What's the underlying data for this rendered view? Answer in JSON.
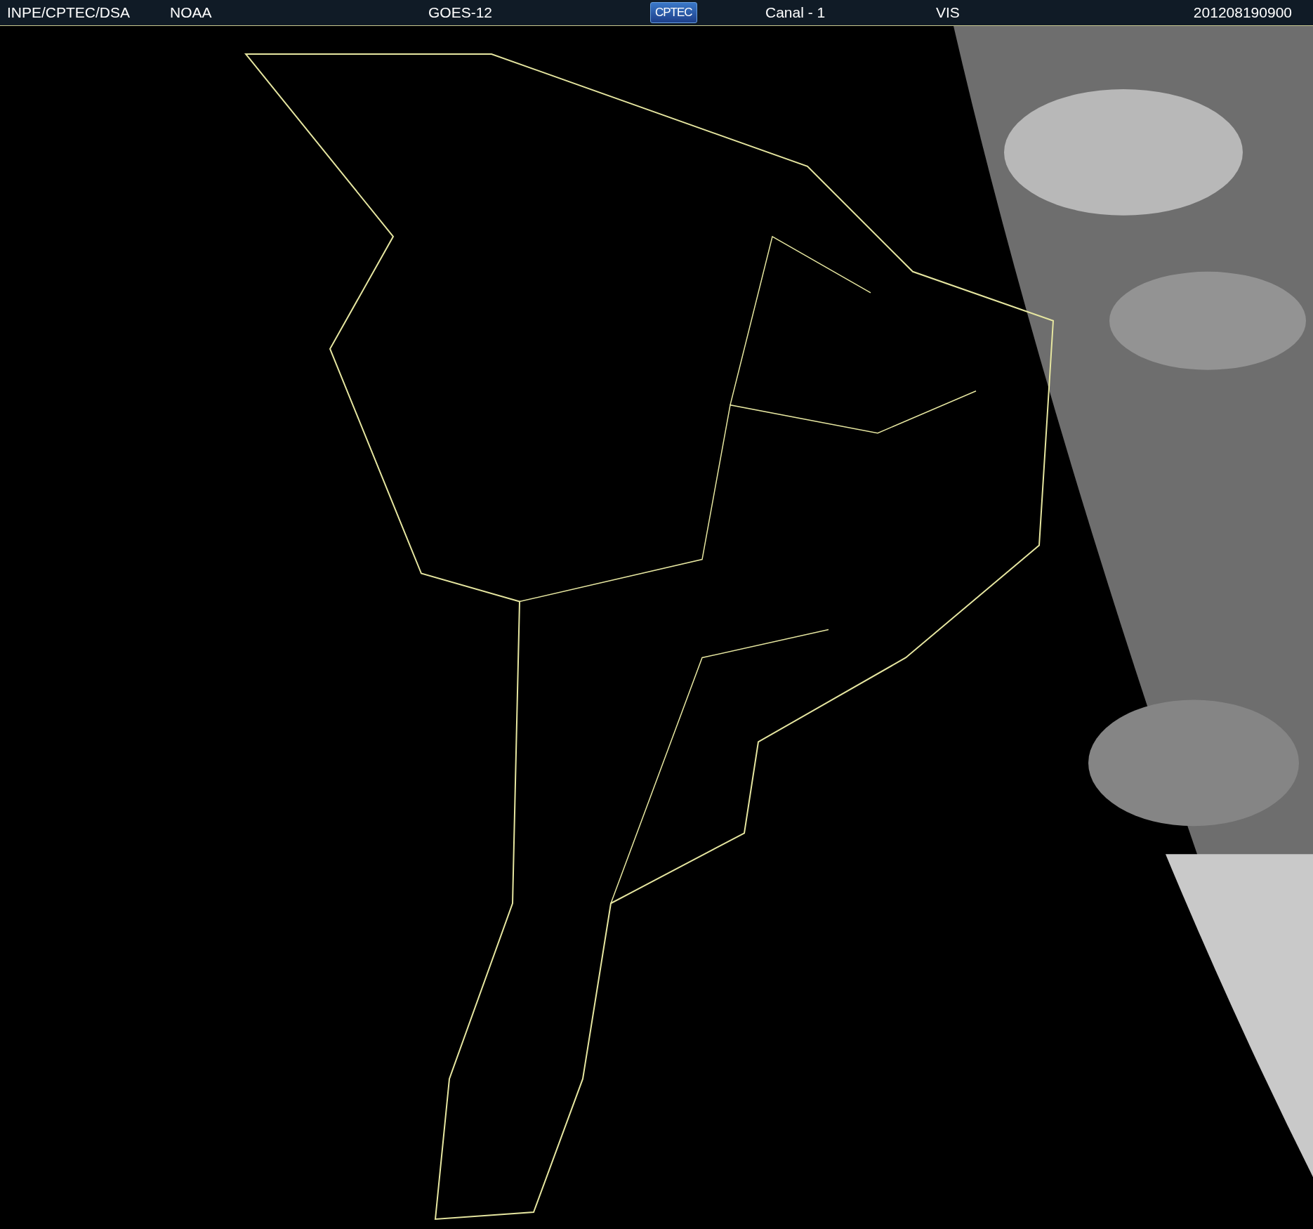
{
  "header": {
    "source": "INPE/CPTEC/DSA",
    "agency": "NOAA",
    "satellite": "GOES-12",
    "logo": "CPTEC",
    "channel": "Canal - 1",
    "band": "VIS",
    "timestamp": "201208190900"
  }
}
